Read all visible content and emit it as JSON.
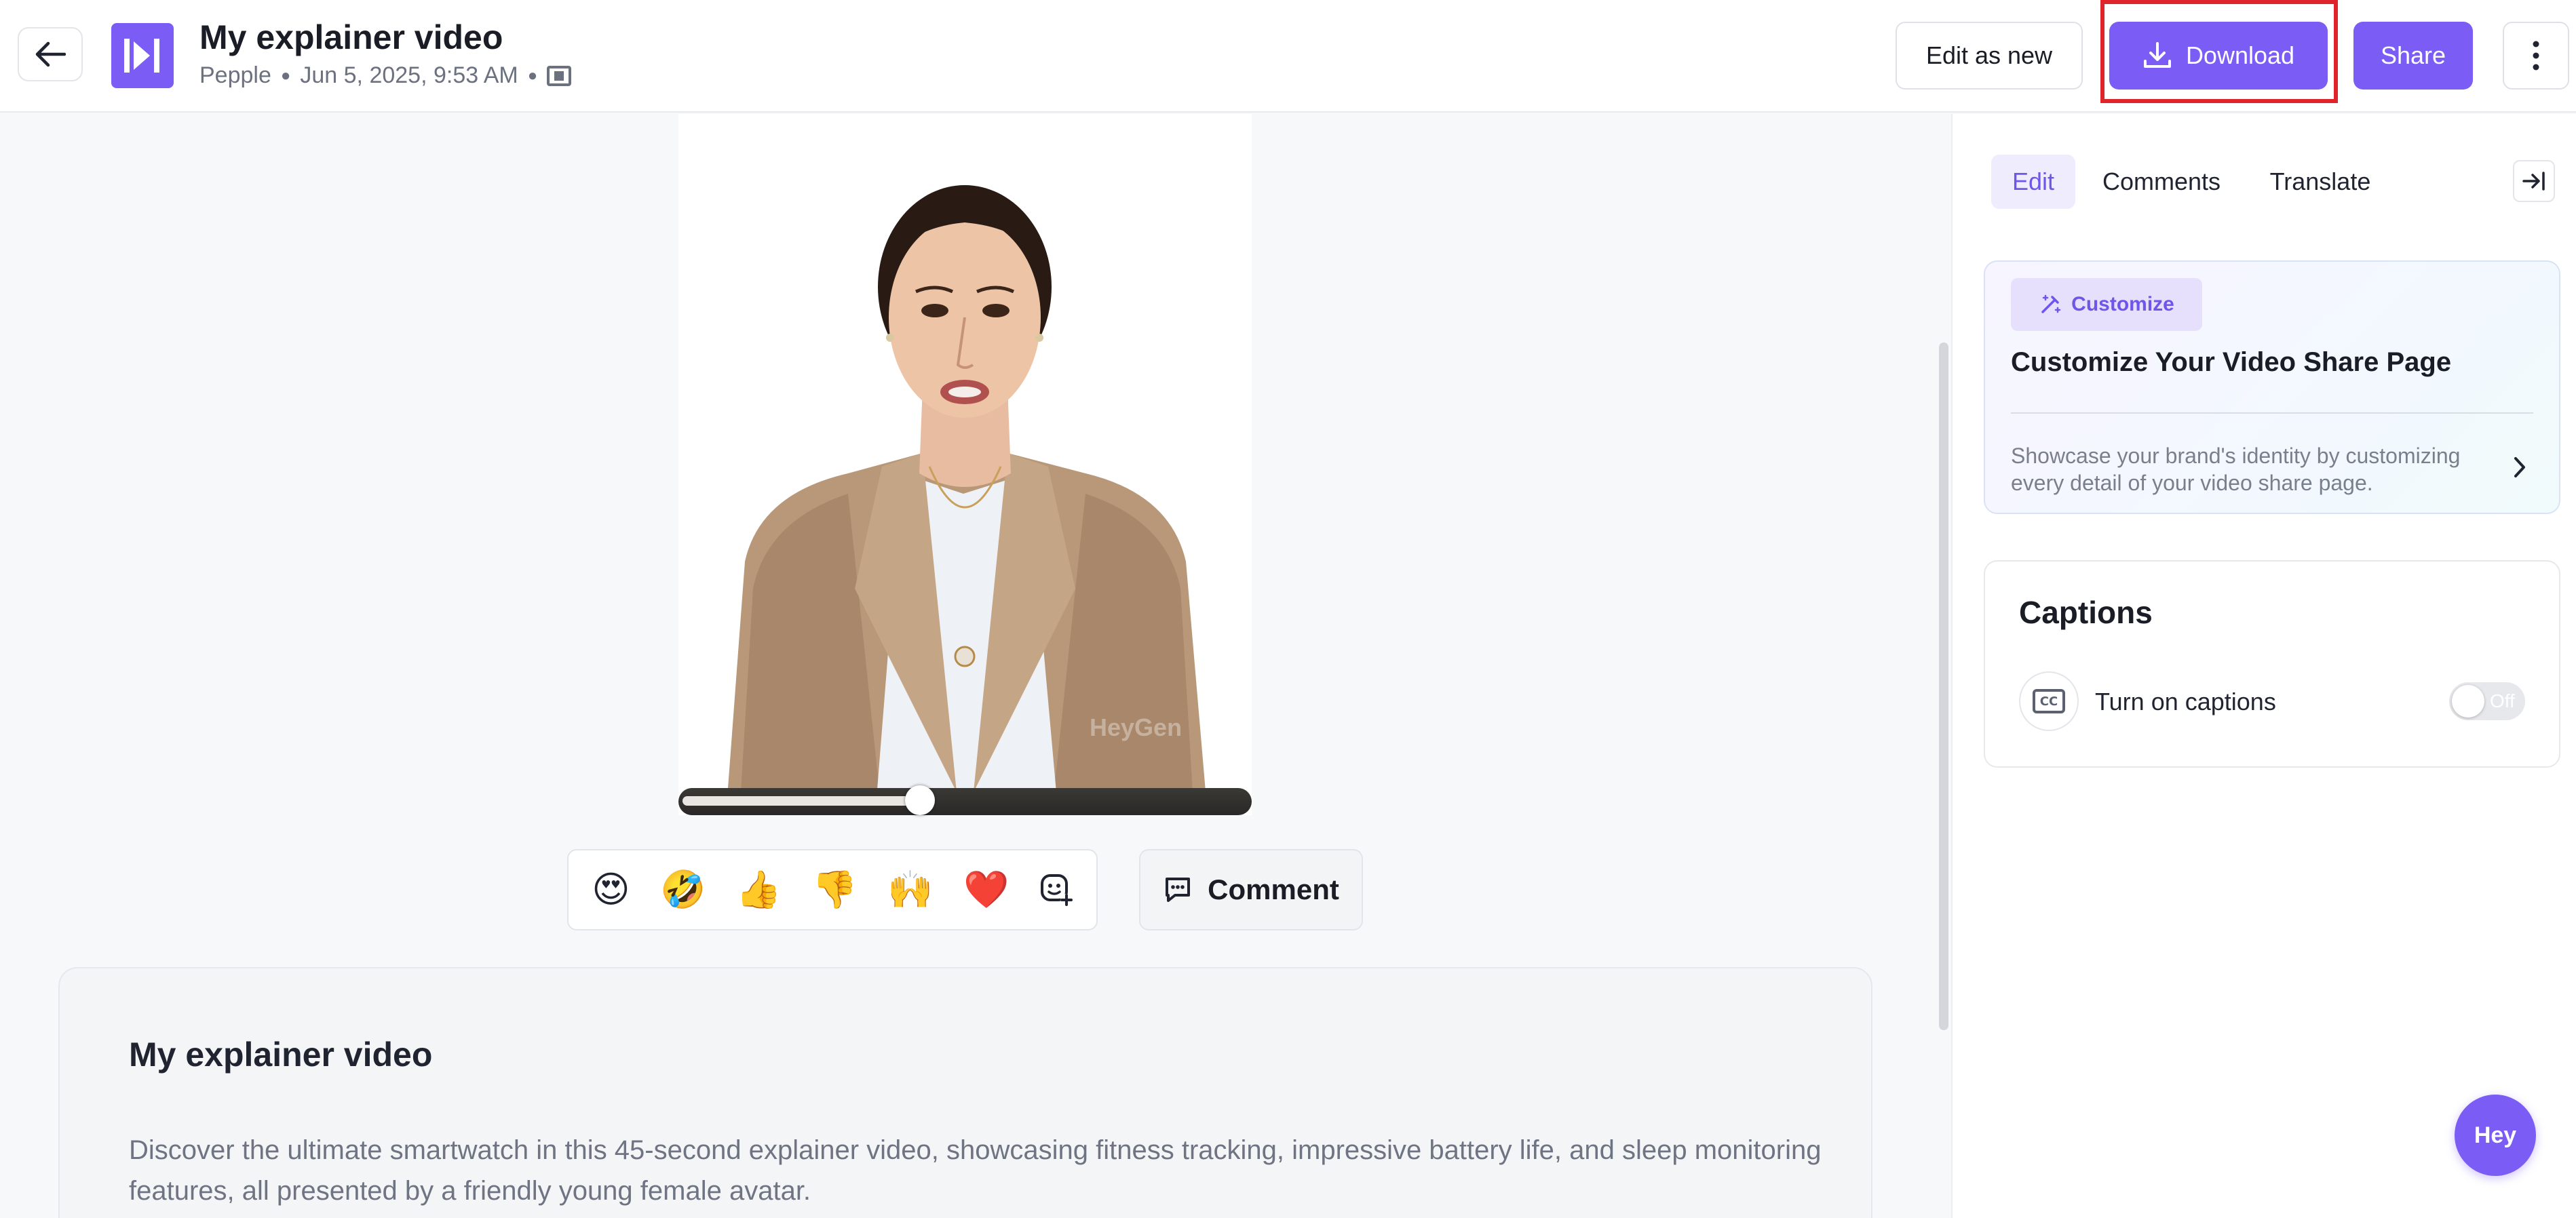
{
  "header": {
    "title": "My explainer video",
    "author": "Pepple",
    "timestamp": "Jun 5, 2025, 9:53 AM",
    "edit_as_new_label": "Edit as new",
    "download_label": "Download",
    "share_label": "Share",
    "back_icon": "arrow-left-icon",
    "more_icon": "more-vertical-icon"
  },
  "video": {
    "watermark": "HeyGen",
    "progress": 0.42
  },
  "reactions": {
    "items": [
      "😍",
      "🤣",
      "👍",
      "👎",
      "🙌",
      "❤️"
    ],
    "add_icon": "add-reaction-icon"
  },
  "comment_button": {
    "label": "Comment"
  },
  "description": {
    "title": "My explainer video",
    "text": "Discover the ultimate smartwatch in this 45-second explainer video, showcasing fitness tracking, impressive battery life, and sleep monitoring features, all presented by a friendly young female avatar."
  },
  "right_panel": {
    "tabs": [
      {
        "label": "Edit",
        "active": true
      },
      {
        "label": "Comments",
        "active": false
      },
      {
        "label": "Translate",
        "active": false
      }
    ],
    "customize": {
      "badge": "Customize",
      "title": "Customize Your Video Share Page",
      "description": "Showcase your brand's identity by customizing every detail of your video share page."
    },
    "captions": {
      "title": "Captions",
      "toggle_label": "Turn on captions",
      "toggle_state": "Off",
      "cc_text": "CC"
    }
  },
  "chat_bubble": {
    "label": "Hey"
  },
  "colors": {
    "accent": "#7b5cf5",
    "highlight": "#e0242b"
  }
}
